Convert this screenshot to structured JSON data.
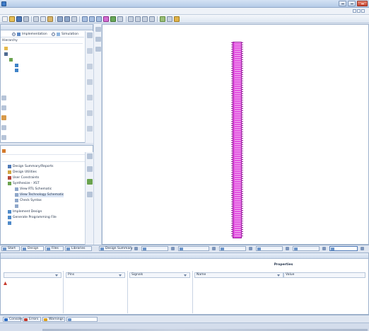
{
  "window": {
    "title": "",
    "controls": {
      "minimize": "",
      "maximize": "",
      "close": ""
    }
  },
  "menu": {
    "items": [
      {
        "label": ""
      },
      {
        "label": ""
      },
      {
        "label": ""
      },
      {
        "label": ""
      },
      {
        "label": ""
      },
      {
        "label": ""
      },
      {
        "label": ""
      },
      {
        "label": ""
      },
      {
        "label": ""
      },
      {
        "label": ""
      }
    ]
  },
  "toolbar": {
    "buttons": [
      "new-icon",
      "open-icon",
      "save-icon",
      "print-icon",
      "cut-icon",
      "copy-icon",
      "paste-icon",
      "undo-icon",
      "redo-icon",
      "find-icon",
      "zoom-in-icon",
      "zoom-out-icon",
      "zoom-fit-icon",
      "select-icon",
      "wire-icon",
      "pan-icon",
      "help-icon"
    ]
  },
  "design_panel": {
    "header_title": "",
    "header_controls": "",
    "view_label": "",
    "view_options": [
      {
        "label": "Implementation",
        "selected": true
      },
      {
        "label": "Simulation",
        "selected": false
      }
    ],
    "hierarchy_title": "Hierarchy",
    "tree": [
      {
        "label": "",
        "icon": "project-icon",
        "depth": 1
      },
      {
        "label": "",
        "icon": "chip-icon",
        "depth": 1
      },
      {
        "label": "",
        "icon": "module-icon",
        "depth": 2
      },
      {
        "label": "",
        "icon": "file-icon",
        "depth": 3
      },
      {
        "label": "",
        "icon": "file-icon",
        "depth": 3
      }
    ]
  },
  "process_panel": {
    "status_label": "",
    "title": "",
    "items": [
      {
        "label": "Design Summary/Reports",
        "icon": "summary-icon",
        "depth": 1
      },
      {
        "label": "Design Utilities",
        "icon": "utilities-icon",
        "depth": 1
      },
      {
        "label": "User Constraints",
        "icon": "constraints-icon",
        "depth": 1
      },
      {
        "label": "Synthesize - XST",
        "icon": "synthesize-icon",
        "depth": 1
      },
      {
        "label": "View RTL Schematic",
        "icon": "schematic-icon",
        "depth": 2
      },
      {
        "label": "View Technology Schematic",
        "icon": "schematic-icon",
        "depth": 2
      },
      {
        "label": "Check Syntax",
        "icon": "check-icon",
        "depth": 2
      },
      {
        "label": "",
        "icon": "simulate-icon",
        "depth": 2
      },
      {
        "label": "Implement Design",
        "icon": "implement-icon",
        "depth": 1
      },
      {
        "label": "Generate Programming File",
        "icon": "program-icon",
        "depth": 1
      },
      {
        "label": "",
        "icon": "target-icon",
        "depth": 1
      }
    ]
  },
  "left_tabs": [
    {
      "label": "Start"
    },
    {
      "label": "Design"
    },
    {
      "label": "Files"
    },
    {
      "label": "Libraries"
    }
  ],
  "doc_tabs": [
    {
      "label": "Design Summary"
    },
    {
      "label": ""
    },
    {
      "label": ""
    },
    {
      "label": ""
    },
    {
      "label": ""
    },
    {
      "label": ""
    },
    {
      "label": "",
      "active": true
    }
  ],
  "bottom_panel": {
    "header_title": "",
    "header_controls": "",
    "left_section": "",
    "right_section": "Properties",
    "columns": [
      {
        "label": ""
      },
      {
        "label": "Pins"
      },
      {
        "label": "Signals"
      },
      {
        "label": "Name"
      },
      {
        "label": "Value"
      }
    ],
    "row_item": ""
  },
  "console_tabs": [
    {
      "label": "Console",
      "color": "#2c6dc6"
    },
    {
      "label": "Errors",
      "color": "#c63a2c"
    },
    {
      "label": "Warnings",
      "color": "#e0a11a"
    },
    {
      "label": "",
      "color": "#6b94c9"
    }
  ],
  "status_bar": {
    "zoom": ""
  },
  "colors": {
    "schematic_cell": "#e251e0",
    "accent": "#3d7bc9"
  }
}
